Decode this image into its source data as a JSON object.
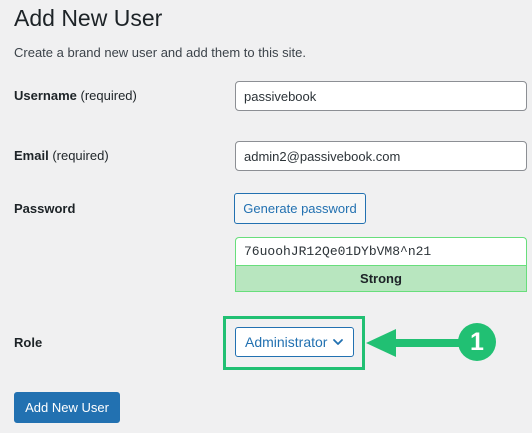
{
  "header": {
    "title": "Add New User",
    "description": "Create a brand new user and add them to this site."
  },
  "form": {
    "username": {
      "label": "Username",
      "required_note": "(required)",
      "value": "passivebook"
    },
    "email": {
      "label": "Email",
      "required_note": "(required)",
      "value": "admin2@passivebook.com"
    },
    "password": {
      "label": "Password",
      "generate_label": "Generate password",
      "value": "76uoohJR12Qe01DYbVM8^n21",
      "strength": "Strong"
    },
    "role": {
      "label": "Role",
      "selected": "Administrator"
    },
    "submit_label": "Add New User"
  },
  "annotation": {
    "step_number": "1"
  },
  "colors": {
    "accent": "#2271b1",
    "highlight": "#21c073",
    "strength_bg": "#b8e6bf",
    "background": "#f0f0f1"
  },
  "icons": {
    "role_dropdown": "chevron-down-icon",
    "pointer": "arrow-left-icon"
  }
}
